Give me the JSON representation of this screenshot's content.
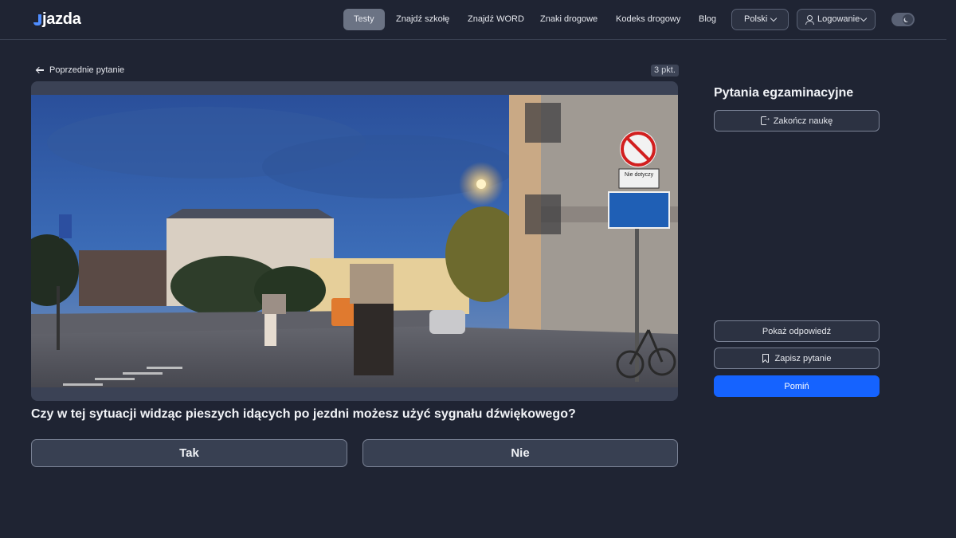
{
  "header": {
    "logo": "jazda",
    "nav": [
      "Testy",
      "Znajdź szkołę",
      "Znajdź WORD",
      "Znaki drogowe",
      "Kodeks drogowy",
      "Blog"
    ],
    "language": "Polski",
    "login": "Logowanie"
  },
  "main": {
    "back_link": "Poprzednie pytanie",
    "points": "3 pkt.",
    "question": "Czy w tej sytuacji widząc pieszych idących po jezdni możesz użyć sygnału dźwiękowego?",
    "answers": [
      "Tak",
      "Nie"
    ],
    "sign_text": "Nie dotyczy"
  },
  "sidebar": {
    "title": "Pytania egzaminacyjne",
    "end_button": "Zakończ naukę",
    "show_answer": "Pokaż odpowiedź",
    "save_question": "Zapisz pytanie",
    "skip": "Pomiń"
  },
  "colors": {
    "background": "#1f2433",
    "accent": "#1563ff"
  },
  "icons": [
    "arrow-left-icon",
    "user-icon",
    "chevron-down-icon",
    "moon-icon",
    "exit-icon",
    "bookmark-icon"
  ]
}
